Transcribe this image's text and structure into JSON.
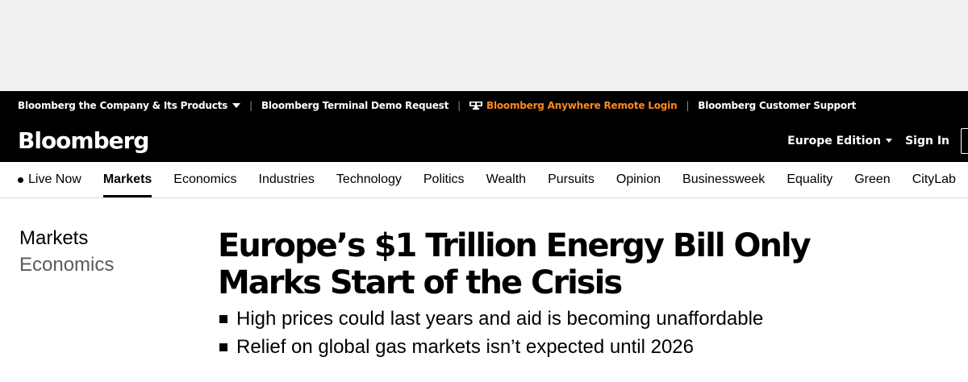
{
  "utility_bar": {
    "company_products": "Bloomberg the Company & Its Products",
    "terminal_demo": "Bloomberg Terminal Demo Request",
    "anywhere_login": "Bloomberg Anywhere Remote Login",
    "customer_support": "Bloomberg Customer Support",
    "separator": "|",
    "accent_color": "#fb8b1e"
  },
  "brand_bar": {
    "logo": "Bloomberg",
    "edition": "Europe Edition",
    "sign_in": "Sign In"
  },
  "nav": {
    "items": [
      {
        "label": "Live Now"
      },
      {
        "label": "Markets",
        "active": true
      },
      {
        "label": "Economics"
      },
      {
        "label": "Industries"
      },
      {
        "label": "Technology"
      },
      {
        "label": "Politics"
      },
      {
        "label": "Wealth"
      },
      {
        "label": "Pursuits"
      },
      {
        "label": "Opinion"
      },
      {
        "label": "Businessweek"
      },
      {
        "label": "Equality"
      },
      {
        "label": "Green"
      },
      {
        "label": "CityLab"
      }
    ]
  },
  "article": {
    "categories": [
      "Markets",
      "Economics"
    ],
    "headline": "Europe’s $1 Trillion Energy Bill Only Marks Start of the Crisis",
    "abstract": [
      "High prices could last years and aid is becoming unaffordable",
      "Relief on global gas markets isn’t expected until 2026"
    ]
  }
}
